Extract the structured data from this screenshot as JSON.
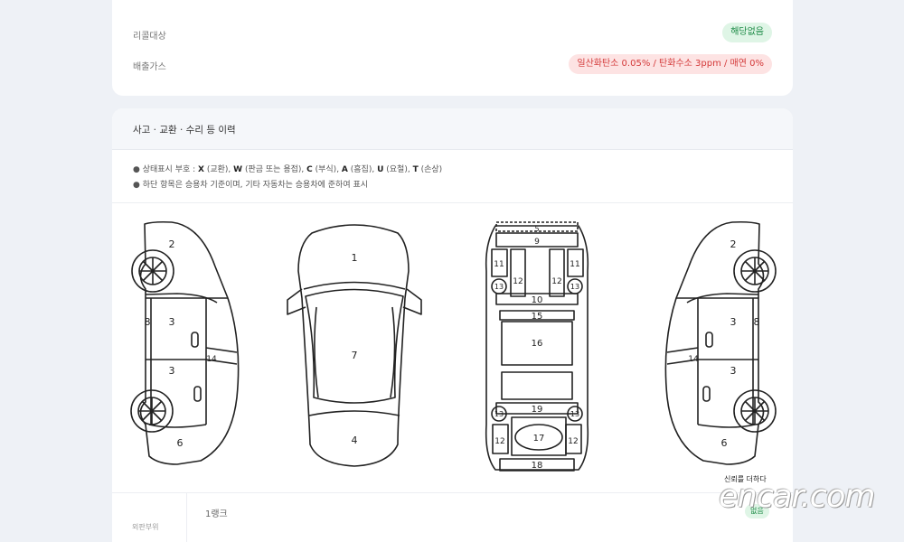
{
  "top_card": {
    "recall_label": "리콜대상",
    "recall_badge": "해당없음",
    "emission_label": "배출가스",
    "emission_badge": "일산화탄소 0.05% / 탄화수소 3ppm / 매연 0%"
  },
  "history": {
    "title": "사고 · 교환 · 수리 등 이력",
    "note1_prefix": "● 상태표시 부호 : ",
    "note1_items": [
      {
        "code": "X",
        "desc": "(교환), "
      },
      {
        "code": "W",
        "desc": "(판금 또는 용접), "
      },
      {
        "code": "C",
        "desc": "(부식), "
      },
      {
        "code": "A",
        "desc": "(흠집), "
      },
      {
        "code": "U",
        "desc": "(요철), "
      },
      {
        "code": "T",
        "desc": "(손상)"
      }
    ],
    "note2": "● 하단 항목은 승용차 기준이며, 기타 자동차는 승용차에 준하여 표시"
  },
  "diagram_labels": {
    "left_side": [
      "2",
      "3",
      "3",
      "8",
      "14",
      "6"
    ],
    "top_view": [
      "1",
      "7",
      "4"
    ],
    "underbody": [
      "5",
      "9",
      "11",
      "11",
      "12",
      "12",
      "13",
      "13",
      "10",
      "15",
      "16",
      "19",
      "13",
      "13",
      "12",
      "17",
      "12",
      "18"
    ],
    "right_side": [
      "2",
      "3",
      "3",
      "8",
      "14",
      "6"
    ]
  },
  "bottom_row": {
    "left_label": "외판부위",
    "rank_label": "1랭크",
    "badge": "없음"
  },
  "watermark": {
    "tagline": "신뢰를 더하다",
    "logo": "encar.com"
  }
}
